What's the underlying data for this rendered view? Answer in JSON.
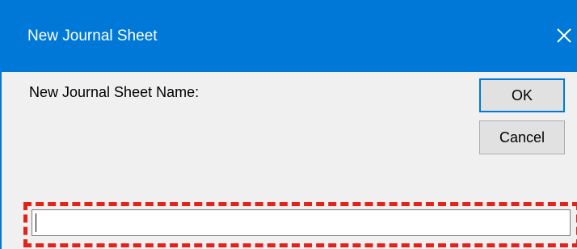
{
  "dialog": {
    "title": "New Journal Sheet",
    "close_icon": "close-icon",
    "prompt_label": "New Journal Sheet Name:",
    "ok_label": "OK",
    "cancel_label": "Cancel",
    "name_value": ""
  },
  "colors": {
    "titlebar": "#0078d7",
    "dialog_background": "#f0f0f0",
    "button_background": "#e1e1e1",
    "default_button_border": "#0078d7",
    "highlight_dash": "#e2231a"
  }
}
